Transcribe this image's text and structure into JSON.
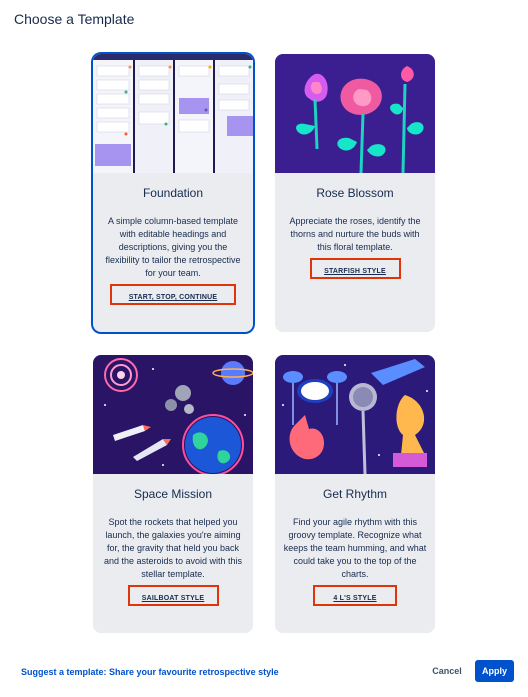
{
  "dialog": {
    "title": "Choose a Template"
  },
  "templates": [
    {
      "name": "Foundation",
      "description": "A simple column-based template with editable headings and descriptions, giving you the flexibility to tailor the retrospective for your team.",
      "style_label": "START, STOP, CONTINUE",
      "selected": true,
      "art": "kanban-board-illustration"
    },
    {
      "name": "Rose Blossom",
      "description": "Appreciate the roses, identify the thorns and nurture the buds with this floral template.",
      "style_label": "STARFISH STYLE",
      "selected": false,
      "art": "roses-illustration"
    },
    {
      "name": "Space Mission",
      "description": "Spot the rockets that helped you launch, the galaxies you're aiming for, the gravity that held you back and the asteroids to avoid with this stellar template.",
      "style_label": "SAILBOAT STYLE",
      "selected": false,
      "art": "space-illustration"
    },
    {
      "name": "Get Rhythm",
      "description": "Find your agile rhythm with this groovy template. Recognize what keeps the team humming, and what could take you to the top of the charts.",
      "style_label": "4 L'S STYLE",
      "selected": false,
      "art": "music-illustration"
    }
  ],
  "footer": {
    "suggest_link": "Suggest a template: Share your favourite retrospective style",
    "cancel_label": "Cancel",
    "apply_label": "Apply"
  },
  "colors": {
    "primary": "#0052cc",
    "highlight_box": "#de350b",
    "card_bg": "#ebecf0",
    "text": "#172b4d"
  }
}
